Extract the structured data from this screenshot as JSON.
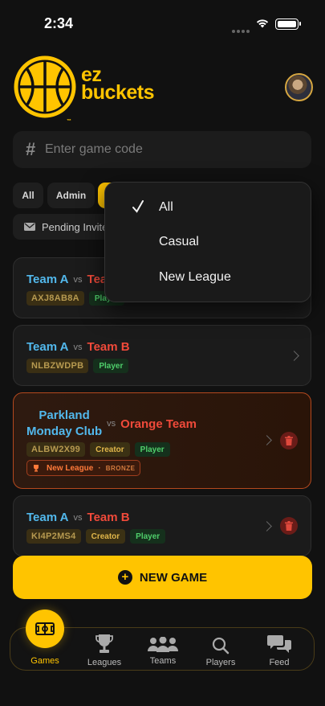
{
  "status": {
    "time": "2:34"
  },
  "brand": {
    "line1": "ez",
    "line2": "buckets",
    "tm": "™"
  },
  "search": {
    "hash": "#",
    "placeholder": "Enter game code"
  },
  "filters": {
    "all": "All",
    "admin": "Admin",
    "pending": "Pending Invites"
  },
  "dropdown": {
    "items": [
      "All",
      "Casual",
      "New League"
    ],
    "selected": "All"
  },
  "games": [
    {
      "team_a": "Team A",
      "vs": "vs",
      "team_b": "Team B",
      "code": "AXJ8AB8A",
      "roles": [
        "Player"
      ]
    },
    {
      "team_a": "Team A",
      "vs": "vs",
      "team_b": "Team B",
      "code": "NLBZWDPB",
      "roles": [
        "Player"
      ]
    },
    {
      "team_a": "Parkland Monday Club",
      "team_a_line1": "Parkland",
      "team_a_line2": "Monday Club",
      "vs": "vs",
      "team_b": "Orange Team",
      "code": "ALBW2X99",
      "roles": [
        "Creator",
        "Player"
      ],
      "league": "New League",
      "tier": "BRONZE"
    },
    {
      "team_a": "Team A",
      "vs": "vs",
      "team_b": "Team B",
      "code": "KI4P2MS4",
      "roles": [
        "Creator",
        "Player"
      ]
    }
  ],
  "new_game": {
    "label": "NEW GAME",
    "plus": "+"
  },
  "tabs": {
    "games": "Games",
    "leagues": "Leagues",
    "teams": "Teams",
    "players": "Players",
    "feed": "Feed"
  },
  "colors": {
    "accent": "#ffc400",
    "team_a": "#52b8ec",
    "team_b": "#f04a3a",
    "background": "#111111"
  }
}
